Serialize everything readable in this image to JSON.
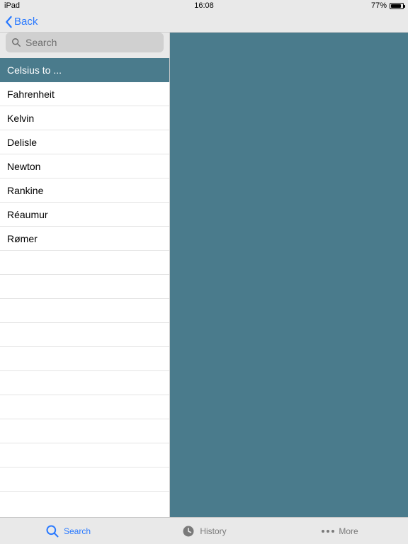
{
  "status": {
    "device": "iPad",
    "time": "16:08",
    "battery": "77%"
  },
  "nav": {
    "back": "Back"
  },
  "search": {
    "placeholder": "Search"
  },
  "section": {
    "title": "Celsius to ..."
  },
  "items": [
    {
      "label": "Fahrenheit"
    },
    {
      "label": "Kelvin"
    },
    {
      "label": "Delisle"
    },
    {
      "label": "Newton"
    },
    {
      "label": "Rankine"
    },
    {
      "label": "Réaumur"
    },
    {
      "label": "Rømer"
    }
  ],
  "tabs": {
    "search": "Search",
    "history": "History",
    "more": "More"
  }
}
